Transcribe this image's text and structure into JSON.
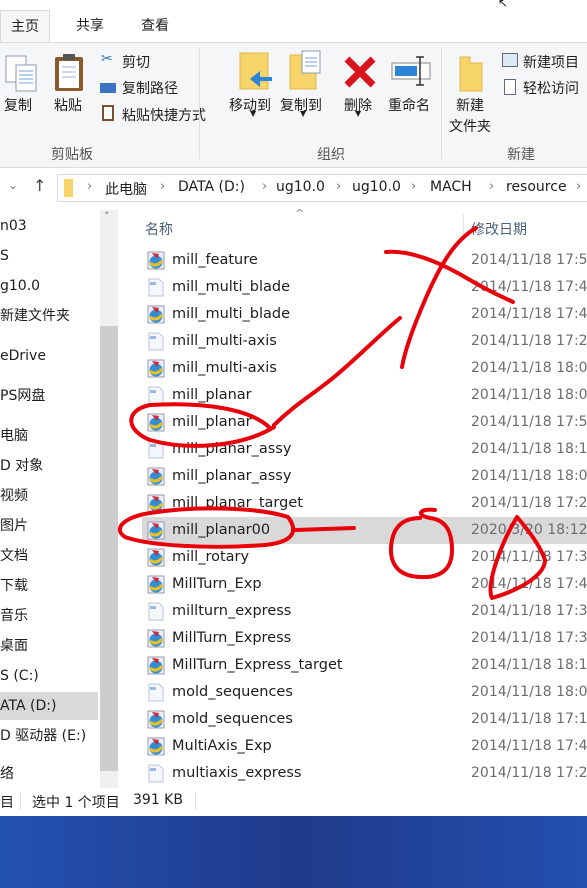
{
  "ribbon": {
    "tabs": [
      "主页",
      "共享",
      "查看"
    ],
    "clipboard": {
      "copy": "复制",
      "paste": "粘贴",
      "cut": "剪切",
      "copy_path": "复制路径",
      "paste_shortcut": "粘贴快捷方式",
      "group": "剪贴板"
    },
    "organize": {
      "move_to": "移动到",
      "copy_to": "复制到",
      "delete": "删除",
      "rename": "重命名",
      "group": "组织"
    },
    "new": {
      "new_folder_1": "新建",
      "new_folder_2": "文件夹",
      "new_item": "新建项目",
      "easy_access": "轻松访问",
      "group": "新建"
    }
  },
  "address": {
    "crumbs": [
      "此电脑",
      "DATA (D:)",
      "ug10.0",
      "ug10.0",
      "MACH",
      "resource"
    ]
  },
  "nav": {
    "items": [
      "n03",
      "S",
      "g10.0",
      "新建文件夹",
      "eDrive",
      "PS网盘",
      "电脑",
      "D 对象",
      "视频",
      "图片",
      "文档",
      "下载",
      "音乐",
      "桌面",
      "S (C:)",
      "ATA (D:)",
      "D 驱动器 (E:)",
      "络"
    ],
    "selected": "ATA (D:)"
  },
  "columns": {
    "name": "名称",
    "date": "修改日期"
  },
  "files": [
    {
      "name": "mill_feature",
      "date": "2014/11/18 17:5",
      "icon": "ug-part-icon"
    },
    {
      "name": "mill_multi_blade",
      "date": "2014/11/18 17:4",
      "icon": "document-icon"
    },
    {
      "name": "mill_multi_blade",
      "date": "2014/11/18 17:4",
      "icon": "ug-part-icon"
    },
    {
      "name": "mill_multi-axis",
      "date": "2014/11/18 17:2",
      "icon": "document-icon"
    },
    {
      "name": "mill_multi-axis",
      "date": "2014/11/18 18:0",
      "icon": "ug-part-icon"
    },
    {
      "name": "mill_planar",
      "date": "2014/11/18 18:0",
      "icon": "document-icon"
    },
    {
      "name": "mill_planar",
      "date": "2014/11/18 17:5",
      "icon": "ug-part-icon"
    },
    {
      "name": "mill_planar_assy",
      "date": "2014/11/18 18:1",
      "icon": "document-icon"
    },
    {
      "name": "mill_planar_assy",
      "date": "2014/11/18 18:0",
      "icon": "ug-part-icon"
    },
    {
      "name": "mill_planar_target",
      "date": "2014/11/18 17:2",
      "icon": "ug-part-icon"
    },
    {
      "name": "mill_planar00",
      "date": "2020/3/20 18:12",
      "icon": "ug-part-icon",
      "selected": true
    },
    {
      "name": "mill_rotary",
      "date": "2014/11/18 17:3",
      "icon": "ug-part-icon"
    },
    {
      "name": "MillTurn_Exp",
      "date": "2014/11/18 17:4",
      "icon": "ug-part-icon"
    },
    {
      "name": "millturn_express",
      "date": "2014/11/18 17:3",
      "icon": "document-icon"
    },
    {
      "name": "MillTurn_Express",
      "date": "2014/11/18 17:3",
      "icon": "ug-part-icon"
    },
    {
      "name": "MillTurn_Express_target",
      "date": "2014/11/18 18:1",
      "icon": "ug-part-icon"
    },
    {
      "name": "mold_sequences",
      "date": "2014/11/18 18:0",
      "icon": "document-icon"
    },
    {
      "name": "mold_sequences",
      "date": "2014/11/18 17:1",
      "icon": "ug-part-icon"
    },
    {
      "name": "MultiAxis_Exp",
      "date": "2014/11/18 17:4",
      "icon": "ug-part-icon"
    },
    {
      "name": "multiaxis_express",
      "date": "2014/11/18 17:2",
      "icon": "document-icon"
    }
  ],
  "status": {
    "count_tail": "目",
    "selection": "选中 1 个项目",
    "size": "391 KB"
  },
  "colors": {
    "annotation": "#e8000b",
    "selection": "#d9d9d9",
    "desktop": "#1f3a8a"
  }
}
